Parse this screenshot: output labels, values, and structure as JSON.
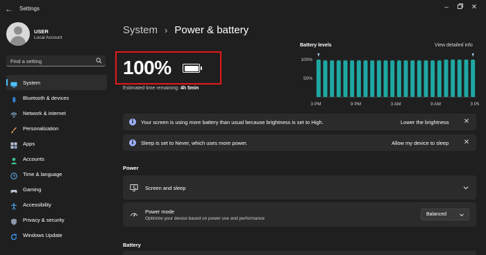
{
  "window": {
    "title": "Settings",
    "back_icon": "back-arrow-icon",
    "controls": [
      "minimize-icon",
      "restore-icon",
      "close-icon"
    ]
  },
  "profile": {
    "name": "USER",
    "account_type": "Local Account"
  },
  "search": {
    "placeholder": "Find a setting",
    "icon": "search-icon"
  },
  "sidebar": {
    "items": [
      {
        "label": "System",
        "icon": "system-icon",
        "active": true
      },
      {
        "label": "Bluetooth & devices",
        "icon": "bluetooth-icon"
      },
      {
        "label": "Network & internet",
        "icon": "network-icon"
      },
      {
        "label": "Personalization",
        "icon": "brush-icon"
      },
      {
        "label": "Apps",
        "icon": "apps-icon"
      },
      {
        "label": "Accounts",
        "icon": "accounts-icon"
      },
      {
        "label": "Time & language",
        "icon": "clock-globe-icon"
      },
      {
        "label": "Gaming",
        "icon": "gamepad-icon"
      },
      {
        "label": "Accessibility",
        "icon": "accessibility-icon"
      },
      {
        "label": "Privacy & security",
        "icon": "shield-icon"
      },
      {
        "label": "Windows Update",
        "icon": "update-icon"
      }
    ]
  },
  "breadcrumb": {
    "parent": "System",
    "separator": "›",
    "current": "Power & battery"
  },
  "battery": {
    "percent_text": "100%",
    "charge_fraction": 1.0,
    "estimate_label": "Estimated time remaining:",
    "estimate_value": "4h 5min"
  },
  "chart_data": {
    "type": "bar",
    "title": "Battery levels",
    "link": "View detailed info",
    "y_ticks": [
      "100%",
      "50%"
    ],
    "x_ticks": [
      "3 PM",
      "9 PM",
      "3 AM",
      "9 AM",
      "3 PM"
    ],
    "ylim": [
      0,
      100
    ],
    "bar_count": 24,
    "values": [
      100,
      98,
      98,
      98,
      98,
      98,
      98,
      98,
      98,
      98,
      98,
      98,
      98,
      98,
      98,
      98,
      98,
      98,
      98,
      100,
      100,
      100,
      100,
      100
    ],
    "color": "#1fa7a3"
  },
  "notices": [
    {
      "text": "Your screen is using more battery than usual because brightness is set to High.",
      "action": "Lower the brightness"
    },
    {
      "text": "Sleep is set to Never, which uses more power.",
      "action": "Allow my device to sleep"
    }
  ],
  "power_section": {
    "title": "Power",
    "screen_sleep": {
      "label": "Screen and sleep",
      "icon": "screen-sleep-icon"
    },
    "power_mode": {
      "label": "Power mode",
      "description": "Optimize your device based on power use and performance",
      "value": "Balanced",
      "icon": "power-mode-gauge-icon"
    }
  },
  "battery_section": {
    "title": "Battery"
  },
  "colors": {
    "accent": "#4cc2ff",
    "background": "#1f1f1f",
    "card": "#2b2b2b",
    "highlight_border": "#e31a1a",
    "chart_bar": "#1fa7a3"
  }
}
